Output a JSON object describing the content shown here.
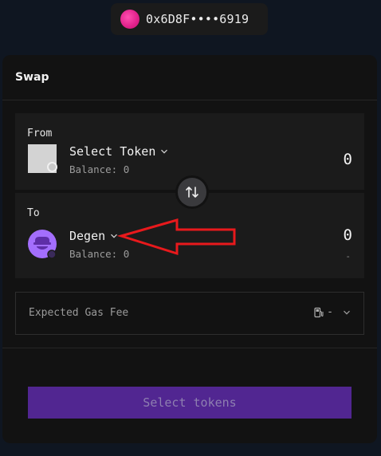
{
  "wallet": {
    "address": "0x6D8F••••6919"
  },
  "swap": {
    "title": "Swap",
    "from": {
      "label": "From",
      "token": "Select Token",
      "balance": "Balance: 0",
      "amount": "0"
    },
    "to": {
      "label": "To",
      "token": "Degen",
      "balance": "Balance: 0",
      "amount": "0",
      "usd_value": "-"
    },
    "gas": {
      "label": "Expected Gas Fee",
      "value": "-"
    },
    "submit_label": "Select tokens"
  },
  "colors": {
    "background": "#0f1621",
    "card": "#121212",
    "panel": "#1b1b1b",
    "submit": "#512691",
    "degen_purple": "#a36efd",
    "annotation_red": "#e8191c"
  },
  "icons": {
    "wallet_avatar": "wallet-avatar-gradient",
    "swap_direction": "swap-arrows-icon",
    "chevron": "chevron-down-icon",
    "gas": "fuel-pump-icon",
    "degen_token": "degen-hat-logo"
  }
}
